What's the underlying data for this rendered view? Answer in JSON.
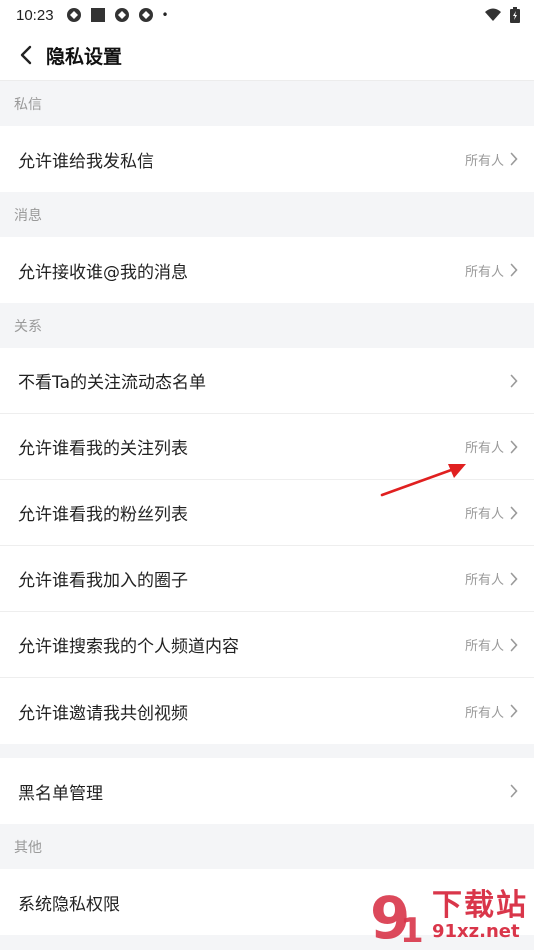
{
  "status_bar": {
    "time": "10:23",
    "dot": "•",
    "icons": [
      "app-icon",
      "app-icon",
      "app-icon",
      "app-icon",
      "wifi-icon",
      "battery-icon"
    ]
  },
  "header": {
    "title": "隐私设置",
    "back_icon": "chevron-left-icon"
  },
  "sections": {
    "private_message": {
      "header": "私信",
      "rows": [
        {
          "label": "允许谁给我发私信",
          "value": "所有人"
        }
      ]
    },
    "messages": {
      "header": "消息",
      "rows": [
        {
          "label": "允许接收谁@我的消息",
          "value": "所有人"
        }
      ]
    },
    "relations": {
      "header": "关系",
      "rows": [
        {
          "label": "不看Ta的关注流动态名单",
          "value": ""
        },
        {
          "label": "允许谁看我的关注列表",
          "value": "所有人"
        },
        {
          "label": "允许谁看我的粉丝列表",
          "value": "所有人"
        },
        {
          "label": "允许谁看我加入的圈子",
          "value": "所有人"
        },
        {
          "label": "允许谁搜索我的个人频道内容",
          "value": "所有人"
        },
        {
          "label": "允许谁邀请我共创视频",
          "value": "所有人"
        }
      ]
    },
    "blacklist": {
      "rows": [
        {
          "label": "黑名单管理",
          "value": ""
        }
      ]
    },
    "other": {
      "header": "其他",
      "rows": [
        {
          "label": "系统隐私权限",
          "value": ""
        }
      ]
    }
  },
  "colors": {
    "annotation_arrow": "#e02020",
    "watermark": "#d9364a"
  },
  "watermark": {
    "logo_text": "9",
    "text": "下载站",
    "url": "91xz.net"
  }
}
